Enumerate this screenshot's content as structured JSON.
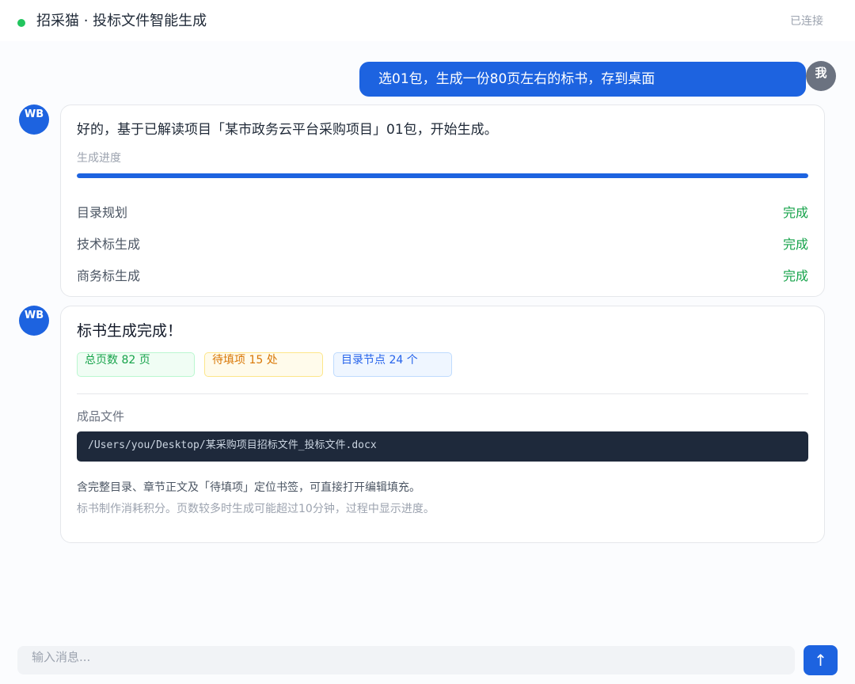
{
  "header": {
    "title": "招采猫 · 投标文件智能生成",
    "connection_status": "已连接",
    "status_color": "#22c55e"
  },
  "user_message": {
    "avatar_label": "我",
    "text": "选01包，生成一份80页左右的标书，存到桌面"
  },
  "bot": {
    "avatar_label": "WB"
  },
  "progress_card": {
    "intro": "好的，基于已解读项目「某市政务云平台采购项目」01包，开始生成。",
    "progress_label": "生成进度",
    "progress_value": 1.0,
    "steps": [
      {
        "name": "目录规划",
        "status": "完成"
      },
      {
        "name": "技术标生成",
        "status": "完成"
      },
      {
        "name": "商务标生成",
        "status": "完成"
      }
    ]
  },
  "result_card": {
    "title": "标书生成完成！",
    "stats": [
      {
        "label": "总页数",
        "value": "82",
        "unit": "页"
      },
      {
        "label": "待填项",
        "value": "15",
        "unit": "处"
      },
      {
        "label": "目录节点",
        "value": "24",
        "unit": "个"
      }
    ],
    "file_label": "成品文件",
    "file_path": "/Users/you/Desktop/某采购项目招标文件_投标文件.docx",
    "note": "含完整目录、章节正文及「待填项」定位书签，可直接打开编辑填充。",
    "hint": "标书制作消耗积分。页数较多时生成可能超过10分钟，过程中显示进度。"
  },
  "composer": {
    "placeholder": "输入消息...",
    "send_icon": "arrow-up-icon",
    "accent_color": "#1d63e0"
  }
}
